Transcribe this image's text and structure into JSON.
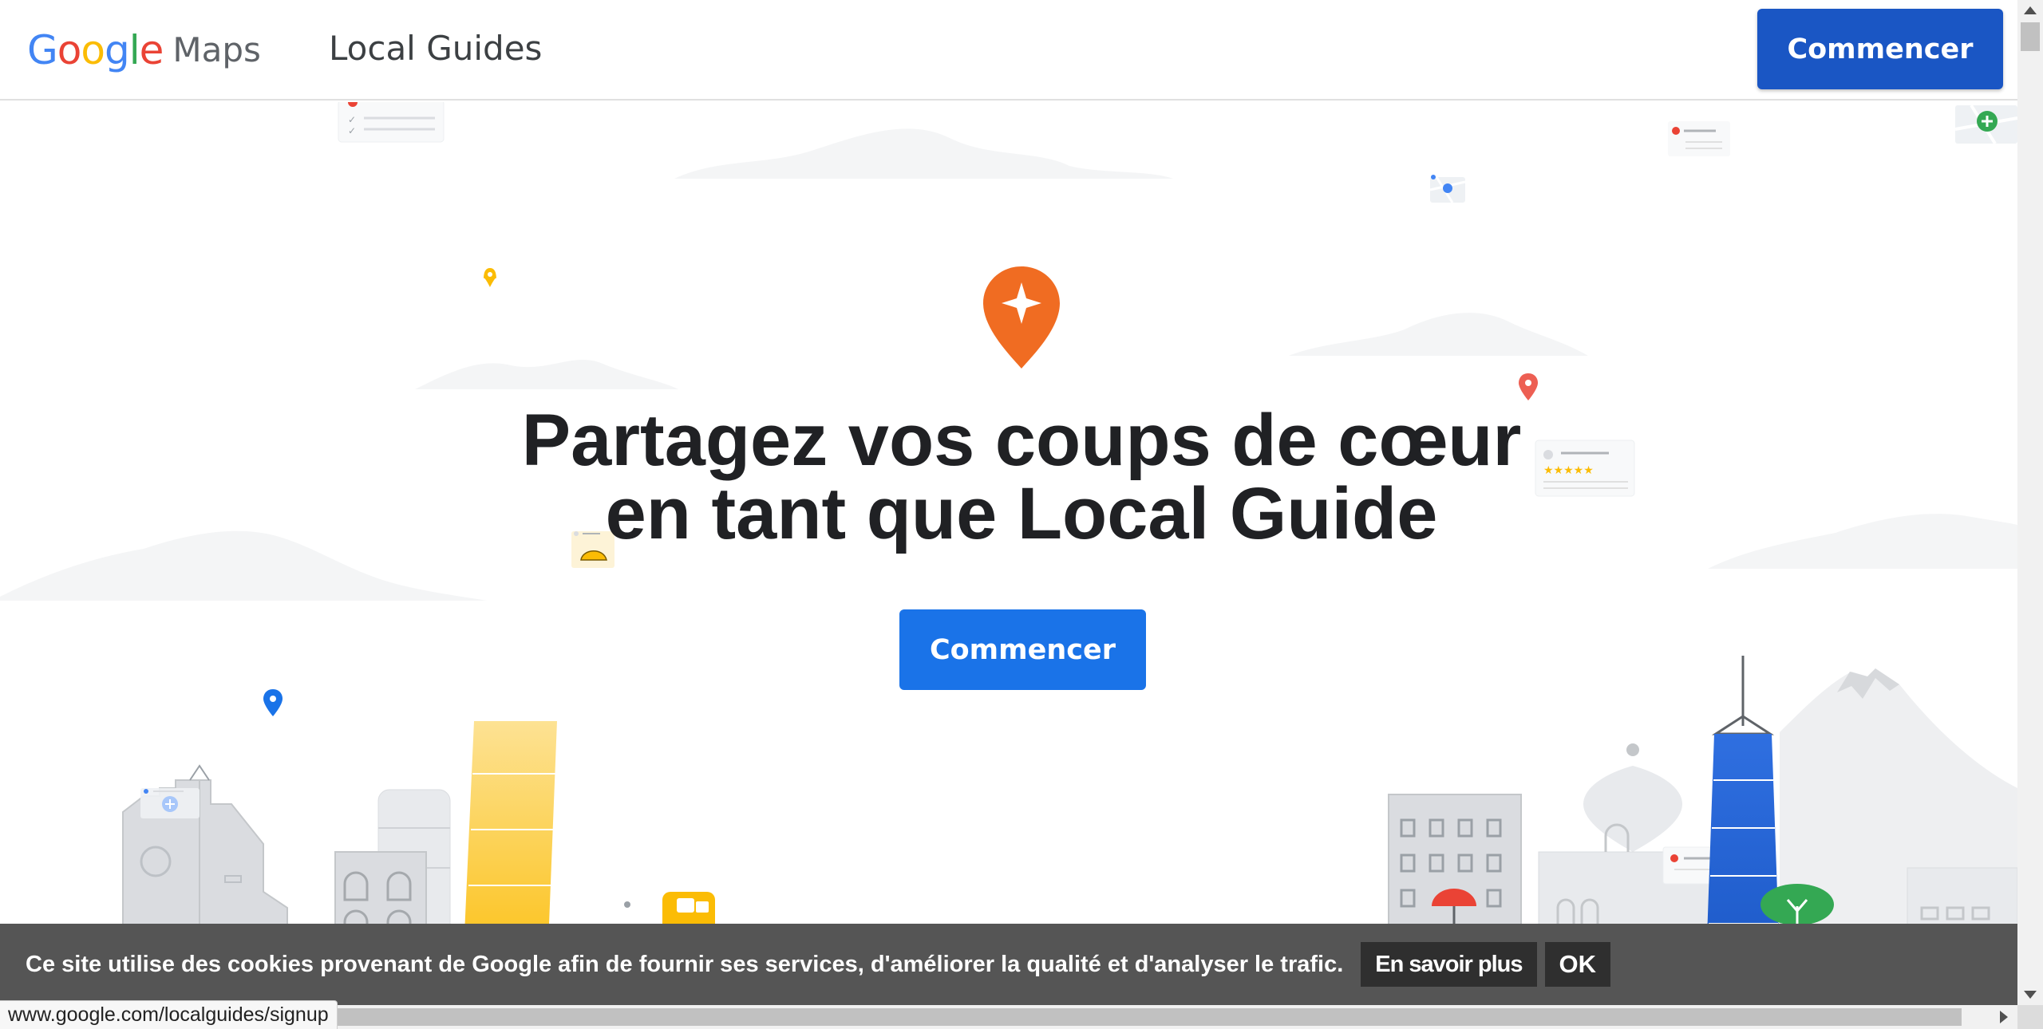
{
  "header": {
    "logo_google_letters": [
      {
        "char": "G",
        "color": "#4285F4"
      },
      {
        "char": "o",
        "color": "#EA4335"
      },
      {
        "char": "o",
        "color": "#FBBC05"
      },
      {
        "char": "g",
        "color": "#4285F4"
      },
      {
        "char": "l",
        "color": "#34A853"
      },
      {
        "char": "e",
        "color": "#EA4335"
      }
    ],
    "logo_maps": "Maps",
    "nav_local_guides": "Local Guides",
    "start_button": "Commencer"
  },
  "hero": {
    "title_line1": "Partagez vos coups de cœur",
    "title_line2": "en tant que Local Guide",
    "start_button": "Commencer",
    "badge_icon": "local-guides-pin-icon",
    "accent_color": "#1a73e8",
    "badge_color": "#F06C22"
  },
  "cookie_banner": {
    "message": "Ce site utilise des cookies provenant de Google afin de fournir ses services, d'améliorer la qualité et d'analyser le trafic.",
    "learn_more": "En savoir plus",
    "ok": "OK"
  },
  "status_bar": {
    "url": "www.google.com/localguides/signup"
  }
}
